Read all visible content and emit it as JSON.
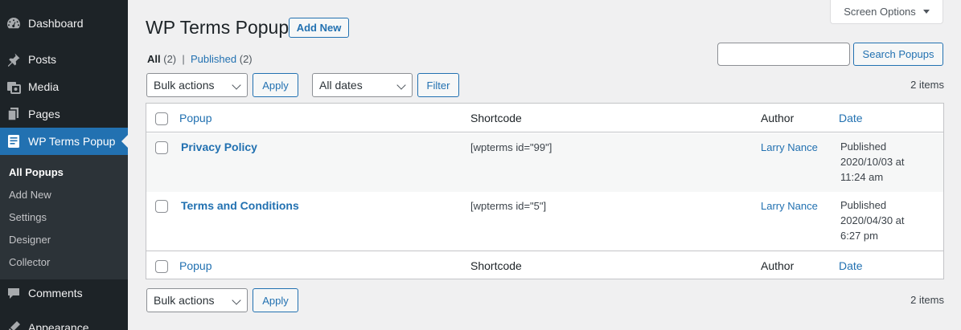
{
  "sidebar": {
    "items": [
      {
        "label": "Dashboard",
        "icon": "dashboard-icon"
      },
      {
        "label": "Posts",
        "icon": "pin-icon"
      },
      {
        "label": "Media",
        "icon": "media-icon"
      },
      {
        "label": "Pages",
        "icon": "pages-icon"
      },
      {
        "label": "WP Terms Popup",
        "icon": "popup-icon"
      },
      {
        "label": "Comments",
        "icon": "comments-icon"
      },
      {
        "label": "Appearance",
        "icon": "appearance-icon"
      }
    ],
    "submenu": [
      "All Popups",
      "Add New",
      "Settings",
      "Designer",
      "Collector"
    ],
    "active_color": "#2271b1"
  },
  "header": {
    "title": "WP Terms Popup",
    "add_new": "Add New",
    "screen_options": "Screen Options"
  },
  "filters": {
    "all_label": "All",
    "all_count": "(2)",
    "separator": "|",
    "published_label": "Published",
    "published_count": "(2)",
    "search_value": "",
    "search_button": "Search Popups",
    "bulk_actions": "Bulk actions",
    "apply": "Apply",
    "dates": "All dates",
    "filter": "Filter",
    "items_count": "2 items"
  },
  "table": {
    "columns": [
      "Popup",
      "Shortcode",
      "Author",
      "Date"
    ],
    "rows": [
      {
        "title": "Privacy Policy",
        "shortcode": "[wpterms id=\"99\"]",
        "author": "Larry Nance",
        "status": "Published",
        "date": "2020/10/03 at",
        "time": "11:24 am"
      },
      {
        "title": "Terms and Conditions",
        "shortcode": "[wpterms id=\"5\"]",
        "author": "Larry Nance",
        "status": "Published",
        "date": "2020/04/30 at",
        "time": "6:27 pm"
      }
    ]
  },
  "bottom": {
    "bulk_actions": "Bulk actions",
    "apply": "Apply",
    "items_count": "2 items"
  }
}
